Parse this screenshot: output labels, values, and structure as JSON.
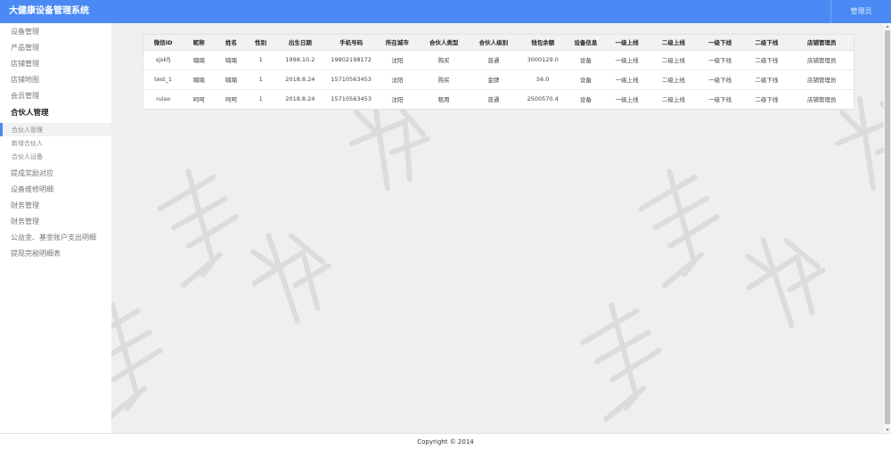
{
  "app": {
    "title": "大健康设备管理系统",
    "user_label": "管理员"
  },
  "sidebar": {
    "items": [
      {
        "label": "设备管理"
      },
      {
        "label": "产品管理"
      },
      {
        "label": "店铺管理"
      },
      {
        "label": "店铺地图"
      },
      {
        "label": "会员管理"
      },
      {
        "label": "合伙人管理"
      },
      {
        "label": "合伙人管理"
      },
      {
        "label": "新增合伙人"
      },
      {
        "label": "合伙人设备"
      },
      {
        "label": "提成奖励对应"
      },
      {
        "label": "设备维修明细"
      },
      {
        "label": "财务管理"
      },
      {
        "label": "财务管理"
      },
      {
        "label": "公益金、基金账户支出明细"
      },
      {
        "label": "提现完税明细表"
      }
    ]
  },
  "table": {
    "columns": [
      "微信ID",
      "昵称",
      "姓名",
      "性别",
      "出生日期",
      "手机号码",
      "所在城市",
      "合伙人类型",
      "合伙人级别",
      "钱包余额",
      "设备信息",
      "一级上线",
      "二级上线",
      "一级下线",
      "二级下线",
      "店铺管理员"
    ],
    "rows": [
      [
        "sjskfj",
        "喃喃",
        "喃喃",
        "1",
        "1998.10.2",
        "19802198172",
        "沈阳",
        "购买",
        "普通",
        "3000129.0",
        "设备",
        "一级上线",
        "二级上线",
        "一级下线",
        "二级下线",
        "店铺管理员"
      ],
      [
        "test_1",
        "喃喃",
        "喃喃",
        "1",
        "2018.8.24",
        "15710563453",
        "沈阳",
        "购买",
        "金牌",
        "56.0",
        "设备",
        "一级上线",
        "二级上线",
        "一级下线",
        "二级下线",
        "店铺管理员"
      ],
      [
        "ruiso",
        "呵呵",
        "呵呵",
        "1",
        "2018.8.24",
        "15710563453",
        "沈阳",
        "租用",
        "普通",
        "2500570.4",
        "设备",
        "一级上线",
        "二级上线",
        "一级下线",
        "二级下线",
        "店铺管理员"
      ]
    ]
  },
  "footer": {
    "copyright": "Copyright © 2014"
  },
  "colors": {
    "accent": "#4b8af4",
    "content_bg": "#efefef"
  }
}
